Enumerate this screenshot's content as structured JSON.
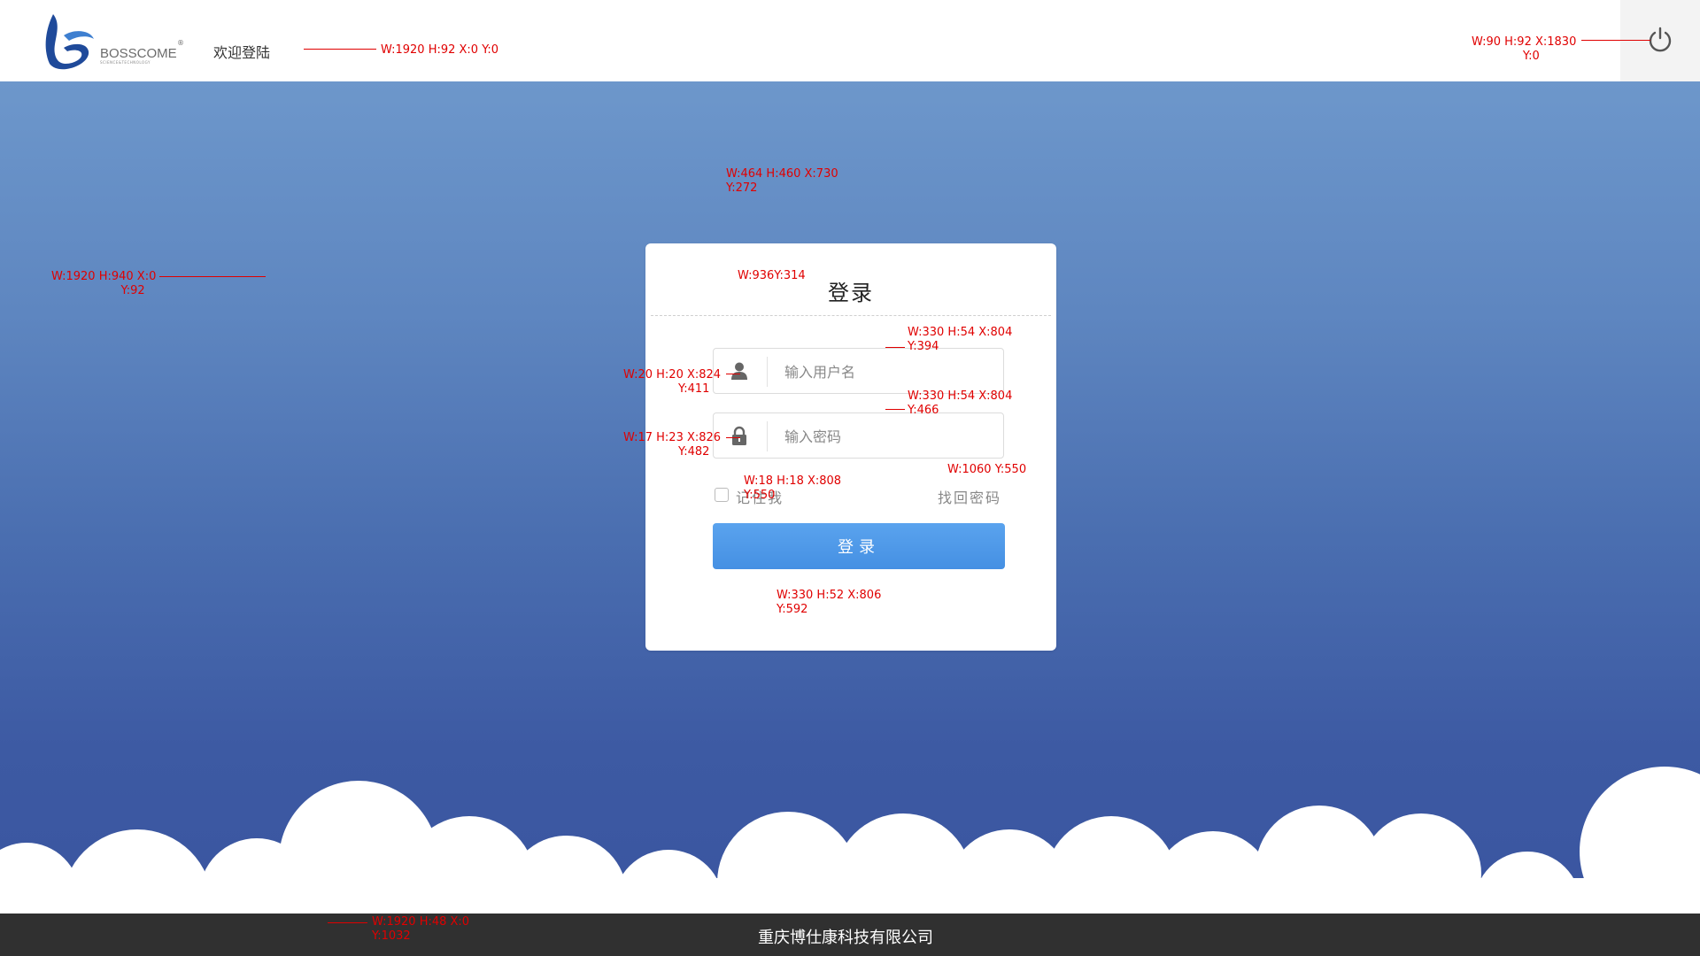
{
  "header": {
    "logo_text": "BOSSCOME",
    "logo_subtext": "SCIENCE&TECHNOLOGY",
    "logo_reg": "®",
    "welcome": "欢迎登陆",
    "power_icon": "power-icon"
  },
  "login": {
    "title": "登录",
    "username_placeholder": "输入用户名",
    "password_placeholder": "输入密码",
    "username_icon": "user-icon",
    "password_icon": "lock-icon",
    "remember_label": "记住我",
    "forgot_label": "找回密码",
    "submit_label": "登录"
  },
  "footer": {
    "company": "重庆博仕康科技有限公司"
  },
  "annotations": {
    "header": "W:1920 H:92 X:0 Y:0",
    "power": "W:90 H:92 X:1830\n              Y:0",
    "card": "W:464 H:460 X:730\nY:272",
    "card_divider": "W:936Y:314",
    "background": "W:1920 H:940 X:0\n                   Y:92",
    "username_box": "W:330 H:54 X:804\nY:394",
    "username_icon": "W:20 H:20 X:824\n               Y:411",
    "password_box": "W:330 H:54 X:804\nY:466",
    "password_icon": "W:17 H:23 X:826\n               Y:482",
    "checkbox": "W:18 H:18 X:808\nY:550",
    "forgot": "W:1060 Y:550",
    "login_button": "W:330 H:52 X:806\nY:592",
    "footer": "W:1920 H:48 X:0\nY:1032"
  },
  "colors": {
    "bg_top": "#6d97cb",
    "bg_bottom": "#3a55a0",
    "button": "#4a94e6",
    "footer": "#303030",
    "annotation": "#e00000"
  }
}
